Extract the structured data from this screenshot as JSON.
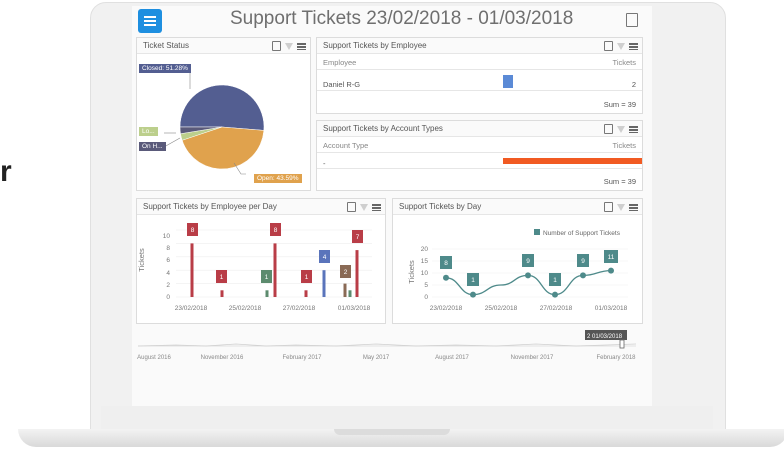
{
  "side_letter": "r",
  "header": {
    "title": "Support Tickets 23/02/2018 - 01/03/2018"
  },
  "ticket_status": {
    "title": "Ticket Status",
    "labels": {
      "closed": "Closed: 51.28%",
      "lo": "Lo...",
      "on_hold": "On H...",
      "open": "Open: 43.59%"
    }
  },
  "by_employee": {
    "title": "Support Tickets by Employee",
    "col_employee": "Employee",
    "col_tickets": "Tickets",
    "row_name": "Daniel R-G",
    "row_value": "2",
    "sum": "Sum = 39"
  },
  "by_account": {
    "title": "Support Tickets by Account Types",
    "col_account": "Account Type",
    "col_tickets": "Tickets",
    "row_name": "-",
    "sum": "Sum = 39"
  },
  "employee_per_day": {
    "title": "Support Tickets by Employee per Day",
    "ylabel": "Tickets",
    "yticks": [
      "0",
      "2",
      "4",
      "6",
      "8",
      "10"
    ],
    "xticks": [
      "23/02/2018",
      "25/02/2018",
      "27/02/2018",
      "01/03/2018"
    ],
    "labels": [
      "8",
      "1",
      "8",
      "1",
      "1",
      "4",
      "2",
      "7"
    ]
  },
  "tickets_by_day": {
    "title": "Support Tickets by Day",
    "legend": "Number of Support Tickets",
    "ylabel": "Tickets",
    "yticks": [
      "0",
      "5",
      "10",
      "15",
      "20"
    ],
    "xticks": [
      "23/02/2018",
      "25/02/2018",
      "27/02/2018",
      "01/03/2018"
    ],
    "labels": [
      "8",
      "1",
      "9",
      "1",
      "9",
      "11"
    ]
  },
  "range": {
    "ticks": [
      "August 2016",
      "November 2016",
      "February 2017",
      "May 2017",
      "August 2017",
      "November 2017",
      "February 2018"
    ],
    "badge": "2 01/03/2018"
  },
  "chart_data": [
    {
      "type": "pie",
      "title": "Ticket Status",
      "categories": [
        "Closed",
        "Open",
        "Lo...",
        "On H..."
      ],
      "values": [
        51.28,
        43.59,
        2.56,
        2.56
      ]
    },
    {
      "type": "bar",
      "title": "Support Tickets by Employee per Day",
      "ylabel": "Tickets",
      "ylim": [
        0,
        10
      ],
      "series": [
        {
          "color": "#b93d47",
          "points": [
            [
              "23/02/2018",
              8
            ],
            [
              "24/02/2018",
              1
            ],
            [
              "26/02/2018",
              8
            ],
            [
              "27/02/2018",
              1
            ],
            [
              "01/03/2018",
              7
            ]
          ]
        },
        {
          "color": "#5c8b6e",
          "points": [
            [
              "26/02/2018",
              1
            ],
            [
              "28/02/2018",
              1
            ]
          ]
        },
        {
          "color": "#5a74bb",
          "points": [
            [
              "28/02/2018",
              4
            ]
          ]
        },
        {
          "color": "#8a6a55",
          "points": [
            [
              "01/03/2018",
              2
            ]
          ]
        }
      ]
    },
    {
      "type": "line",
      "title": "Support Tickets by Day",
      "ylabel": "Tickets",
      "ylim": [
        0,
        20
      ],
      "x": [
        "23/02/2018",
        "24/02/2018",
        "25/02/2018",
        "26/02/2018",
        "27/02/2018",
        "28/02/2018",
        "01/03/2018"
      ],
      "series": [
        {
          "name": "Number of Support Tickets",
          "values": [
            8,
            1,
            5,
            9,
            1,
            9,
            11
          ]
        }
      ]
    }
  ],
  "colors": {
    "accent": "#1e8fe0",
    "pie_closed": "#535e91",
    "pie_open": "#e0a24d",
    "pie_lo": "#bccf8c",
    "pie_on": "#5a5a7a",
    "line": "#4e8a8a",
    "account_bar": "#f15a22",
    "employee_bar": "#5b8ad6"
  }
}
